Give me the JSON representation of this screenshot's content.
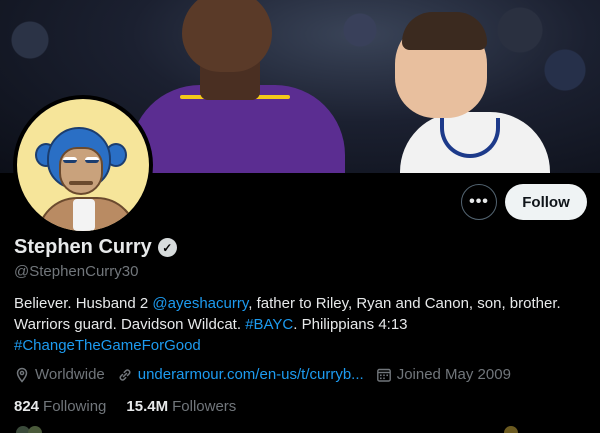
{
  "profile": {
    "display_name": "Stephen Curry",
    "handle": "@StephenCurry30",
    "bio": {
      "part1": "Believer. Husband 2 ",
      "mention": "@ayeshacurry",
      "part2": ", father to Riley, Ryan and Canon, son, brother.",
      "part3": "Warriors guard. Davidson Wildcat. ",
      "hashtag1": "#BAYC",
      "part4": ". Philippians 4:13",
      "hashtag2": "#ChangeTheGameForGood"
    },
    "location": "Worldwide",
    "website": "underarmour.com/en-us/t/curryb...",
    "joined": "Joined May 2009",
    "following_count": "824",
    "following_label": "Following",
    "followers_count": "15.4M",
    "followers_label": "Followers"
  },
  "actions": {
    "more_label": "•••",
    "follow_label": "Follow"
  },
  "icons": {
    "verified": "verified-badge-icon",
    "location": "location-pin-icon",
    "link": "link-icon",
    "calendar": "calendar-icon"
  },
  "colors": {
    "background": "#000000",
    "link": "#1d9bf0",
    "secondary_text": "#71767b",
    "follow_button_bg": "#eff3f4"
  }
}
